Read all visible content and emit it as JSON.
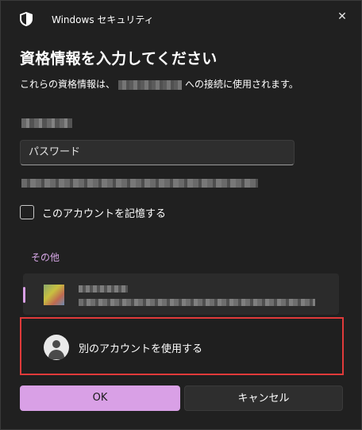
{
  "window": {
    "app_title": "Windows セキュリティ",
    "close_glyph": "✕"
  },
  "dialog": {
    "heading": "資格情報を入力してください",
    "subtitle_prefix": "これらの資格情報は、",
    "subtitle_suffix": "への接続に使用されます。",
    "password_placeholder": "パスワード",
    "remember_label": "このアカウントを記憶する",
    "remember_checked": false,
    "other_section_label": "その他",
    "use_other_account_label": "別のアカウントを使用する",
    "ok_label": "OK",
    "cancel_label": "キャンセル"
  },
  "colors": {
    "accent": "#d9a0e6",
    "highlight_border": "#e03a3a",
    "background": "#202020"
  },
  "icons": {
    "app": "shield-icon",
    "close": "close-icon",
    "other_account": "person-icon"
  }
}
